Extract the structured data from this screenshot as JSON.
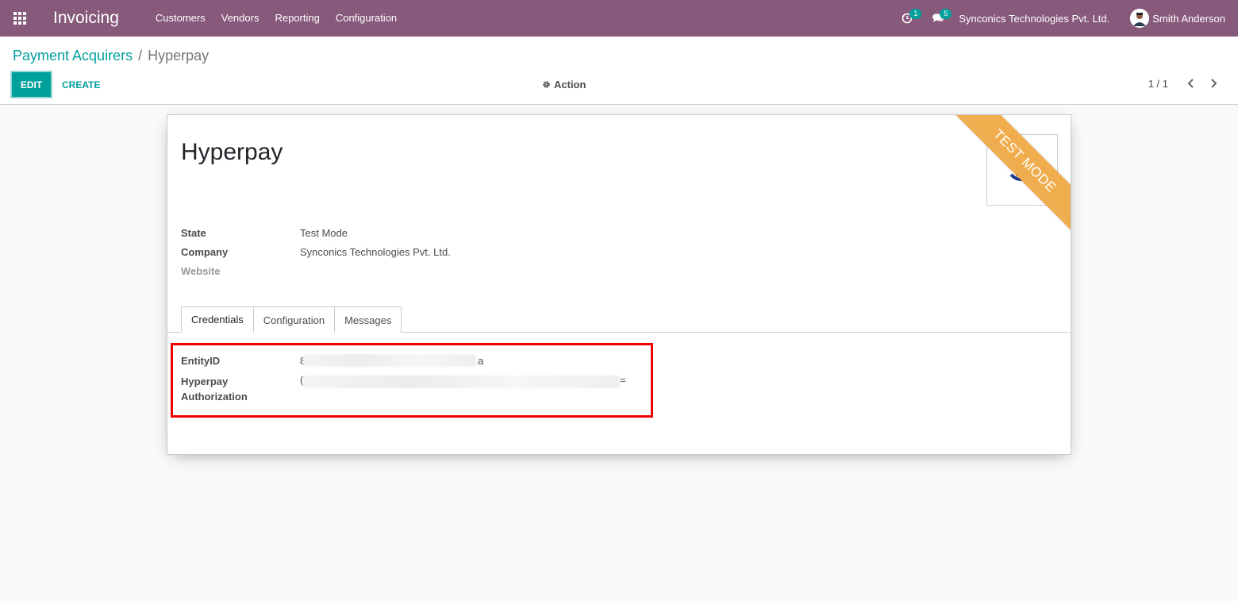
{
  "navbar": {
    "app_name": "Invoicing",
    "menu": [
      "Customers",
      "Vendors",
      "Reporting",
      "Configuration"
    ],
    "activity_count": "1",
    "messages_count": "5",
    "company": "Synconics Technologies Pvt. Ltd.",
    "user": "Smith Anderson",
    "icons": [
      "apps-grid-icon",
      "clock-icon",
      "comments-icon",
      "avatar"
    ]
  },
  "breadcrumb": {
    "parent": "Payment Acquirers",
    "separator": "/",
    "current": "Hyperpay"
  },
  "control_panel": {
    "edit_label": "EDIT",
    "create_label": "CREATE",
    "action_label": "Action",
    "pager": "1 / 1"
  },
  "form": {
    "title": "Hyperpay",
    "ribbon": "TEST MODE",
    "fields": {
      "state_label": "State",
      "state_value": "Test Mode",
      "company_label": "Company",
      "company_value": "Synconics Technologies Pvt. Ltd.",
      "website_label": "Website"
    },
    "tabs": [
      "Credentials",
      "Configuration",
      "Messages"
    ],
    "credentials": {
      "entity_label": "EntityID",
      "entity_prefix": "8",
      "entity_suffix": "a",
      "auth_label_1": "Hyperpay",
      "auth_label_2": "Authorization",
      "auth_prefix": "(",
      "auth_suffix": "="
    }
  },
  "colors": {
    "primary": "#875a7b",
    "accent": "#00a09d",
    "ribbon": "#f0ad4e",
    "highlight": "#ee0000"
  }
}
